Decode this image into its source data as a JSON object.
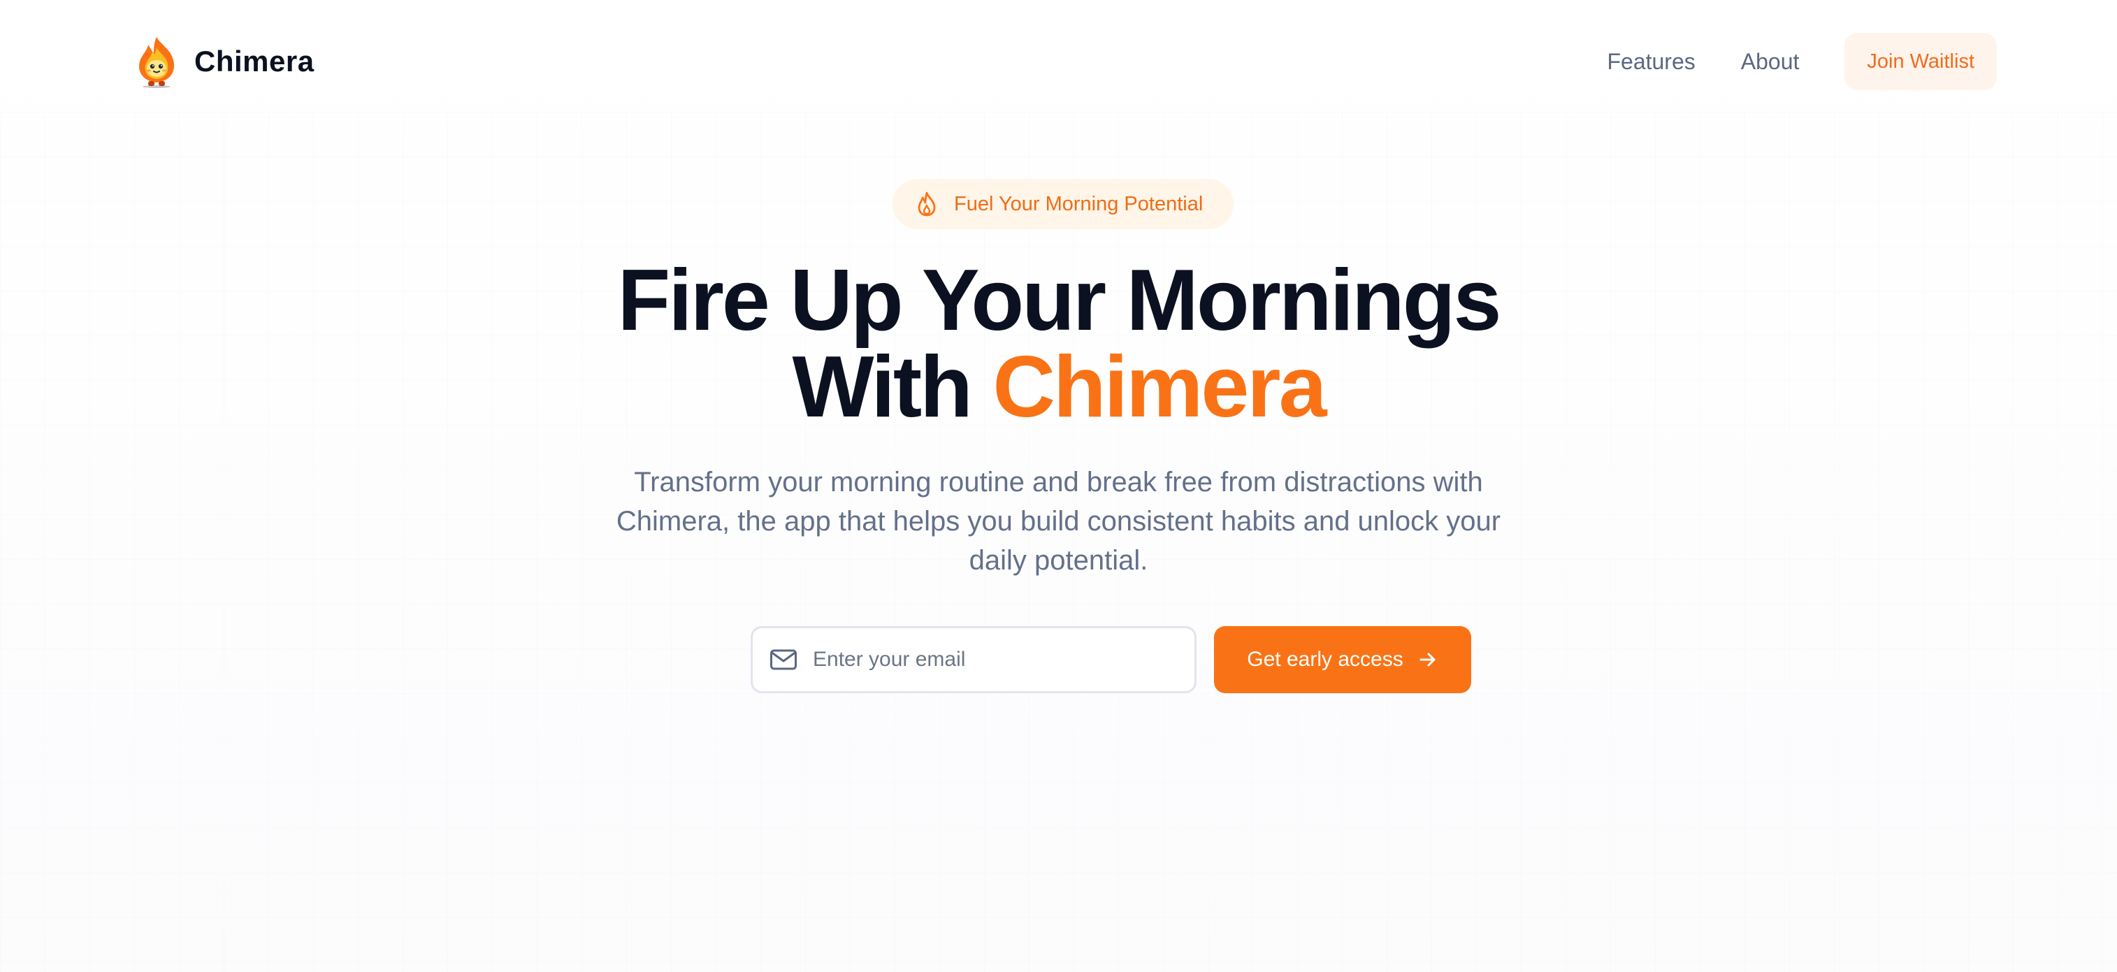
{
  "nav": {
    "brand_name": "Chimera",
    "logo_icon": "flame-mascot-icon",
    "links": [
      {
        "label": "Features"
      },
      {
        "label": "About"
      }
    ],
    "waitlist_label": "Join Waitlist"
  },
  "hero": {
    "badge_text": "Fuel Your Morning Potential",
    "badge_icon": "flame-icon",
    "title_line1": "Fire Up Your Mornings",
    "title_line2_prefix": "With ",
    "title_line2_accent": "Chimera",
    "subtitle": "Transform your morning routine and break free from distractions with Chimera, the app that helps you build consistent habits and unlock your daily potential."
  },
  "signup": {
    "email_placeholder": "Enter your email",
    "email_value": "",
    "email_icon": "mail-icon",
    "cta_label": "Get early access",
    "cta_icon": "arrow-right-icon"
  },
  "colors": {
    "accent": "#f97316",
    "heading": "#0b1120",
    "muted": "#64708a",
    "badge_bg": "#fff5e8",
    "waitlist_bg": "#fff4ec"
  }
}
